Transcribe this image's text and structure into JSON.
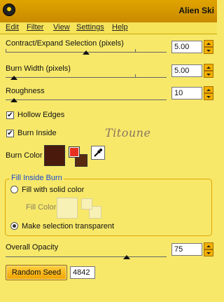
{
  "window": {
    "title": "Alien Ski"
  },
  "menu": [
    {
      "label": "Edit"
    },
    {
      "label": "Filter"
    },
    {
      "label": "View"
    },
    {
      "label": "Settings"
    },
    {
      "label": "Help"
    }
  ],
  "contract_expand": {
    "label": "Contract/Expand Selection (pixels)",
    "value": "5.00",
    "slider_fraction": 0.5
  },
  "burn_width": {
    "label": "Burn Width (pixels)",
    "value": "5.00",
    "slider_fraction": 0.05
  },
  "roughness": {
    "label": "Roughness",
    "value": "10",
    "slider_fraction": 0.05
  },
  "hollow_edges": {
    "label": "Hollow Edges",
    "checked": true
  },
  "burn_inside": {
    "label": "Burn Inside",
    "checked": true
  },
  "signature": "Titoune",
  "burn_color": {
    "label": "Burn Color",
    "main": "#4a1a0c",
    "alt_front": "#e83020",
    "alt_back": "#5a2a10"
  },
  "fill_inside_burn": {
    "title": "Fill Inside Burn",
    "option_solid": "Fill with solid color",
    "fill_color_label": "Fill Color",
    "option_transparent": "Make selection transparent",
    "selected": "transparent"
  },
  "overall_opacity": {
    "label": "Overall Opacity",
    "value": "75",
    "slider_fraction": 0.75
  },
  "random_seed": {
    "button": "Random Seed",
    "value": "4842"
  }
}
